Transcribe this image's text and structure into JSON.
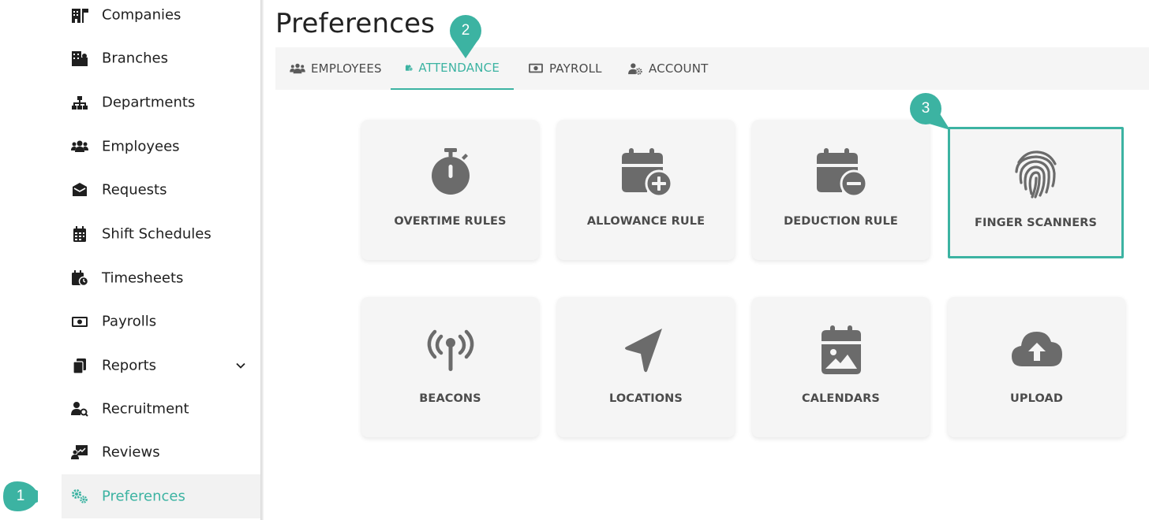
{
  "sidebar": {
    "items": [
      {
        "label": "Companies",
        "icon": "building-flag-icon"
      },
      {
        "label": "Branches",
        "icon": "city-icon"
      },
      {
        "label": "Departments",
        "icon": "sitemap-icon"
      },
      {
        "label": "Employees",
        "icon": "users-icon"
      },
      {
        "label": "Requests",
        "icon": "envelope-open-icon"
      },
      {
        "label": "Shift Schedules",
        "icon": "calendar-grid-icon"
      },
      {
        "label": "Timesheets",
        "icon": "calendar-clock-icon"
      },
      {
        "label": "Payrolls",
        "icon": "money-bill-icon"
      },
      {
        "label": "Reports",
        "icon": "copy-icon"
      },
      {
        "label": "Recruitment",
        "icon": "user-search-icon"
      },
      {
        "label": "Reviews",
        "icon": "chalkboard-user-icon"
      },
      {
        "label": "Preferences",
        "icon": "gears-icon"
      }
    ],
    "active": "Preferences"
  },
  "main": {
    "title": "Preferences",
    "tabs": [
      {
        "label": "EMPLOYEES",
        "icon": "users-icon"
      },
      {
        "label": "ATTENDANCE",
        "icon": "calendar-clock-icon"
      },
      {
        "label": "PAYROLL",
        "icon": "money-bill-icon"
      },
      {
        "label": "ACCOUNT",
        "icon": "user-gear-icon"
      }
    ],
    "active_tab": "ATTENDANCE",
    "cards": [
      {
        "label": "OVERTIME RULES",
        "icon": "stopwatch-icon"
      },
      {
        "label": "ALLOWANCE RULE",
        "icon": "calendar-plus-icon"
      },
      {
        "label": "DEDUCTION RULE",
        "icon": "calendar-minus-icon"
      },
      {
        "label": "FINGER SCANNERS",
        "icon": "fingerprint-icon"
      },
      {
        "label": "BEACONS",
        "icon": "tower-broadcast-icon"
      },
      {
        "label": "LOCATIONS",
        "icon": "location-arrow-icon"
      },
      {
        "label": "CALENDARS",
        "icon": "calendar-image-icon"
      },
      {
        "label": "UPLOAD",
        "icon": "cloud-upload-icon"
      }
    ]
  },
  "callouts": [
    "1",
    "2",
    "3"
  ],
  "colors": {
    "accent": "#3cb3a2",
    "icon": "#6b6b6b",
    "text": "#1f1f1f"
  }
}
